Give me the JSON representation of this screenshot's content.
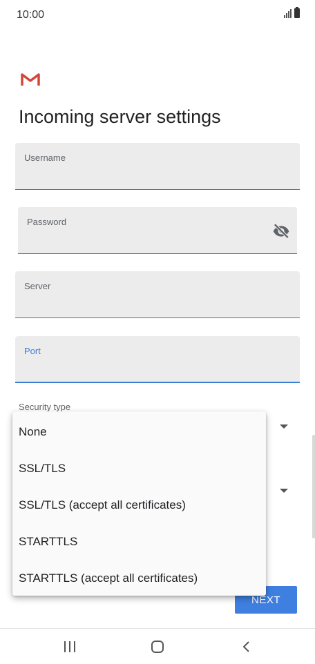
{
  "status_bar": {
    "time": "10:00"
  },
  "icons": {
    "gmail": "gmail-icon",
    "visibility": "visibility-off-icon",
    "dropdown": "arrow-drop-down-icon",
    "nav_recents": "recents-icon",
    "nav_home": "home-icon",
    "nav_back": "back-icon"
  },
  "colors": {
    "accent": "#3f7fe0",
    "focused": "#3b7ed6",
    "field_bg": "#ececec",
    "gmail_red": "#d44638"
  },
  "page": {
    "title": "Incoming server settings"
  },
  "fields": {
    "username": {
      "label": "Username",
      "value": ""
    },
    "password": {
      "label": "Password",
      "value": ""
    },
    "server": {
      "label": "Server",
      "value": ""
    },
    "port": {
      "label": "Port",
      "value": ""
    }
  },
  "security_type": {
    "label": "Security type"
  },
  "menu": {
    "options": [
      "None",
      "SSL/TLS",
      "SSL/TLS (accept all certificates)",
      "STARTTLS",
      "STARTTLS (accept all certificates)"
    ]
  },
  "buttons": {
    "next": "NEXT"
  }
}
